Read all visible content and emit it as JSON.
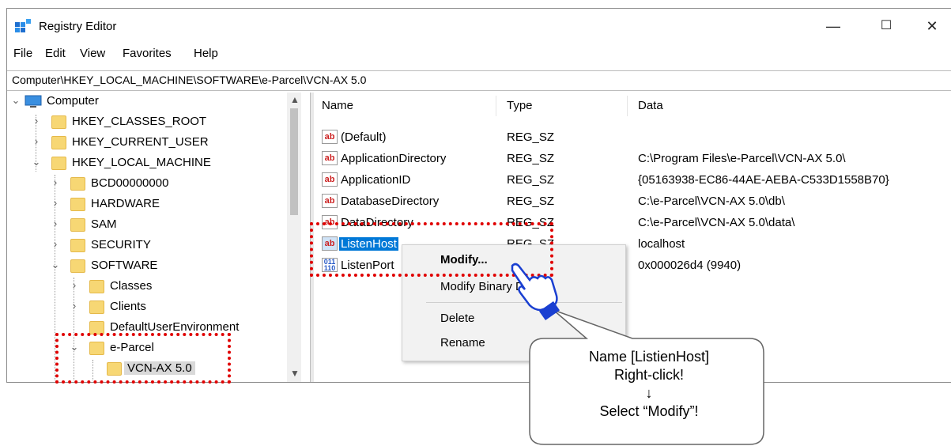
{
  "window": {
    "title": "Registry Editor",
    "controls": {
      "minimize": "—",
      "maximize": "☐",
      "close": "✕"
    }
  },
  "menu": [
    "File",
    "Edit",
    "View",
    "Favorites",
    "Help"
  ],
  "address": "Computer\\HKEY_LOCAL_MACHINE\\SOFTWARE\\e-Parcel\\VCN-AX 5.0",
  "tree": {
    "computer": "Computer",
    "nodes": [
      "HKEY_CLASSES_ROOT",
      "HKEY_CURRENT_USER",
      "HKEY_LOCAL_MACHINE",
      "BCD00000000",
      "HARDWARE",
      "SAM",
      "SECURITY",
      "SOFTWARE",
      "Classes",
      "Clients",
      "DefaultUserEnvironment",
      "e-Parcel",
      "VCN-AX 5.0"
    ]
  },
  "columns": {
    "name": "Name",
    "type": "Type",
    "data": "Data"
  },
  "values": [
    {
      "icon": "ab",
      "name": "(Default)",
      "type": "REG_SZ",
      "data": ""
    },
    {
      "icon": "ab",
      "name": "ApplicationDirectory",
      "type": "REG_SZ",
      "data": "C:\\Program Files\\e-Parcel\\VCN-AX 5.0\\"
    },
    {
      "icon": "ab",
      "name": "ApplicationID",
      "type": "REG_SZ",
      "data": "{05163938-EC86-44AE-AEBA-C533D1558B70}"
    },
    {
      "icon": "ab",
      "name": "DatabaseDirectory",
      "type": "REG_SZ",
      "data": "C:\\e-Parcel\\VCN-AX 5.0\\db\\"
    },
    {
      "icon": "ab",
      "name": "DataDirectory",
      "type": "REG_SZ",
      "data": "C:\\e-Parcel\\VCN-AX 5.0\\data\\"
    },
    {
      "icon": "ab",
      "name": "ListenHost",
      "type": "REG_SZ",
      "data": "localhost"
    },
    {
      "icon": "011\n110",
      "name": "ListenPort",
      "type": "",
      "data": "0x000026d4 (9940)"
    }
  ],
  "context_menu": {
    "modify": "Modify...",
    "modify_binary": "Modify Binary Data...",
    "delete": "Delete",
    "rename": "Rename"
  },
  "callout": {
    "line1": "Name [ListienHost]",
    "line2": "Right-click!",
    "arrow": "↓",
    "line3": "Select “Modify”!"
  },
  "colors": {
    "highlight": "#0078d7",
    "annotation_red": "#e00000",
    "cursor_blue": "#1a3fd1"
  }
}
